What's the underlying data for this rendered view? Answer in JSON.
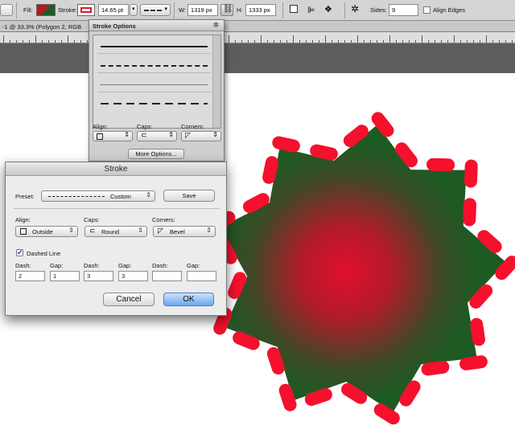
{
  "options_bar": {
    "fill_label": "Fill:",
    "stroke_label": "Stroke:",
    "stroke_width": "14.65 pt",
    "w_label": "W:",
    "width": "1319 px",
    "h_label": "H:",
    "height": "1333 px",
    "sides_label": "Sides:",
    "sides": "9",
    "align_edges": "Align Edges",
    "fill_color": "#b01d23",
    "stroke_color": "#d9182d"
  },
  "doc_tab": {
    "title": "-1 @ 33.3% (Polygon 2, RGB"
  },
  "stroke_options": {
    "title": "Stroke Options",
    "align_label": "Align:",
    "caps_label": "Caps:",
    "corners_label": "Corners:",
    "more_options": "More Options..."
  },
  "stroke_dialog": {
    "title": "Stroke",
    "preset_label": "Preset:",
    "preset_value": "Custom",
    "save": "Save",
    "align_label": "Align:",
    "align_value": "Outside",
    "caps_label": "Caps:",
    "caps_value": "Round",
    "corners_label": "Corners:",
    "corners_value": "Bevel",
    "dashed_line_label": "Dashed Line",
    "dashed_line_checked": true,
    "dash_labels": [
      "Dash:",
      "Gap:",
      "Dash:",
      "Gap:",
      "Dash:",
      "Gap:"
    ],
    "dash_values": [
      "2",
      "1",
      "3",
      "3",
      "",
      ""
    ],
    "cancel": "Cancel",
    "ok": "OK"
  },
  "colors": {
    "shape_center": "#e0102e",
    "shape_edge": "#1e5a24",
    "stroke_dash": "#f5102d",
    "pasteboard": "#5d5d5d",
    "ok_button": "#6aa8ee"
  }
}
